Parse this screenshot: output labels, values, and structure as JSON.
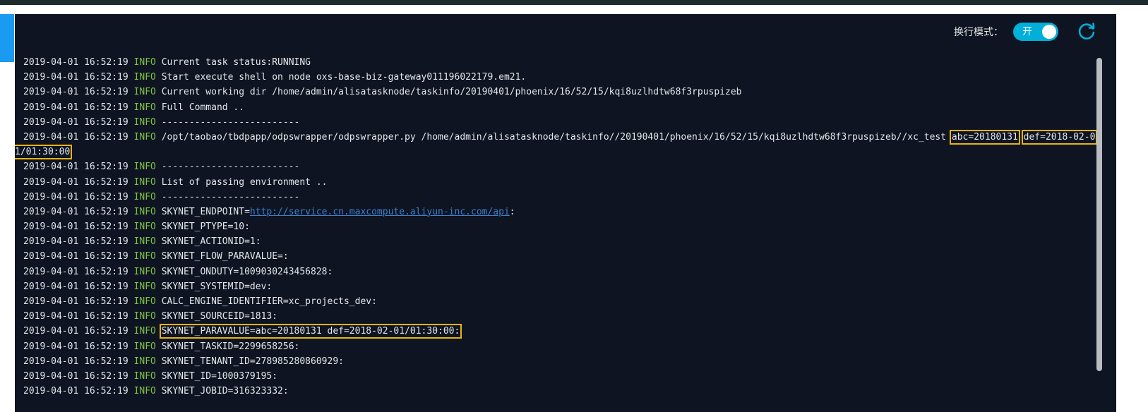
{
  "toolbar": {
    "wrap_mode_label": "换行模式：",
    "toggle_text": "开",
    "toggle_on": true
  },
  "colors": {
    "panel_bg": "#0e1421",
    "info_level": "#7fc242",
    "link": "#3e7fcc",
    "highlight_box": "#e8b410",
    "toggle_bg": "#00b0d8",
    "refresh_icon": "#00b0d8"
  },
  "icons": {
    "refresh": "refresh-icon"
  },
  "log": {
    "lines": [
      {
        "ts": "2019-04-01 16:52:19",
        "level": "INFO",
        "msg": "Current task status:RUNNING"
      },
      {
        "ts": "2019-04-01 16:52:19",
        "level": "INFO",
        "msg": "Start execute shell on node oxs-base-biz-gateway011196022179.em21."
      },
      {
        "ts": "2019-04-01 16:52:19",
        "level": "INFO",
        "msg": "Current working dir /home/admin/alisatasknode/taskinfo/20190401/phoenix/16/52/15/kqi8uzlhdtw68f3rpuspizeb"
      },
      {
        "ts": "2019-04-01 16:52:19",
        "level": "INFO",
        "msg": "Full Command .."
      },
      {
        "ts": "2019-04-01 16:52:19",
        "level": "INFO",
        "msg": "-------------------------"
      },
      {
        "ts": "2019-04-01 16:52:19",
        "level": "INFO",
        "msg": "/opt/taobao/tbdpapp/odpswrapper/odpswrapper.py /home/admin/alisatasknode/taskinfo//20190401/phoenix/16/52/15/kqi8uzlhdtw68f3rpuspizeb//xc_test",
        "param1": "abc=20180131",
        "param2a": "def=2018-02-0",
        "param2b": "1/01:30:00"
      },
      {
        "ts": "2019-04-01 16:52:19",
        "level": "INFO",
        "msg": "-------------------------"
      },
      {
        "ts": "2019-04-01 16:52:19",
        "level": "INFO",
        "msg": "List of passing environment .."
      },
      {
        "ts": "2019-04-01 16:52:19",
        "level": "INFO",
        "msg": "-------------------------"
      },
      {
        "ts": "2019-04-01 16:52:19",
        "level": "INFO",
        "msg": "SKYNET_ENDPOINT=",
        "link": "http://service.cn.maxcompute.aliyun-inc.com/api",
        "after": ":"
      },
      {
        "ts": "2019-04-01 16:52:19",
        "level": "INFO",
        "msg": "SKYNET_PTYPE=10:"
      },
      {
        "ts": "2019-04-01 16:52:19",
        "level": "INFO",
        "msg": "SKYNET_ACTIONID=1:"
      },
      {
        "ts": "2019-04-01 16:52:19",
        "level": "INFO",
        "msg": "SKYNET_FLOW_PARAVALUE=:"
      },
      {
        "ts": "2019-04-01 16:52:19",
        "level": "INFO",
        "msg": "SKYNET_ONDUTY=1009030243456828:"
      },
      {
        "ts": "2019-04-01 16:52:19",
        "level": "INFO",
        "msg": "SKYNET_SYSTEMID=dev:"
      },
      {
        "ts": "2019-04-01 16:52:19",
        "level": "INFO",
        "msg": "CALC_ENGINE_IDENTIFIER=xc_projects_dev:"
      },
      {
        "ts": "2019-04-01 16:52:19",
        "level": "INFO",
        "msg": "SKYNET_SOURCEID=1813:"
      },
      {
        "ts": "2019-04-01 16:52:19",
        "level": "INFO",
        "msg": "SKYNET_PARAVALUE=abc=20180131 def=2018-02-01/01:30:00:"
      },
      {
        "ts": "2019-04-01 16:52:19",
        "level": "INFO",
        "msg": "SKYNET_TASKID=2299658256:"
      },
      {
        "ts": "2019-04-01 16:52:19",
        "level": "INFO",
        "msg": "SKYNET_TENANT_ID=278985280860929:"
      },
      {
        "ts": "2019-04-01 16:52:19",
        "level": "INFO",
        "msg": "SKYNET_ID=1000379195:"
      },
      {
        "ts": "2019-04-01 16:52:19",
        "level": "INFO",
        "msg": "SKYNET_JOBID=316323332:"
      }
    ]
  }
}
